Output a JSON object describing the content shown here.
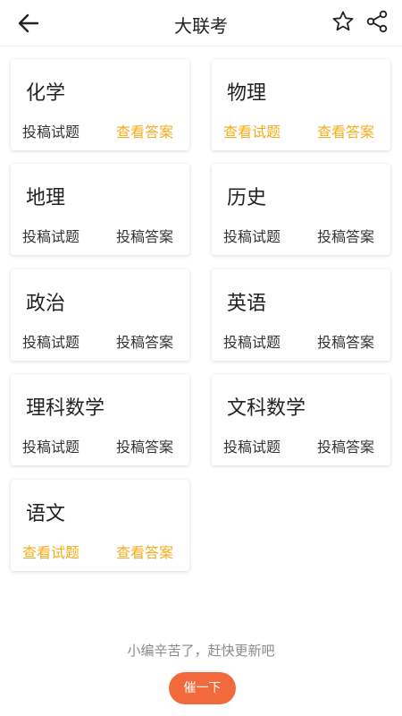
{
  "header": {
    "title": "大联考"
  },
  "colors": {
    "highlight": "#f3ad1b",
    "button": "#f26a3c"
  },
  "cards": [
    {
      "name": "化学",
      "left": "投稿试题",
      "right": "查看答案",
      "left_state": "normal",
      "right_state": "highlight"
    },
    {
      "name": "物理",
      "left": "查看试题",
      "right": "查看答案",
      "left_state": "highlight",
      "right_state": "highlight"
    },
    {
      "name": "地理",
      "left": "投稿试题",
      "right": "投稿答案",
      "left_state": "normal",
      "right_state": "normal"
    },
    {
      "name": "历史",
      "left": "投稿试题",
      "right": "投稿答案",
      "left_state": "normal",
      "right_state": "normal"
    },
    {
      "name": "政治",
      "left": "投稿试题",
      "right": "投稿答案",
      "left_state": "normal",
      "right_state": "normal"
    },
    {
      "name": "英语",
      "left": "投稿试题",
      "right": "投稿答案",
      "left_state": "normal",
      "right_state": "normal"
    },
    {
      "name": "理科数学",
      "left": "投稿试题",
      "right": "投稿答案",
      "left_state": "normal",
      "right_state": "normal"
    },
    {
      "name": "文科数学",
      "left": "投稿试题",
      "right": "投稿答案",
      "left_state": "normal",
      "right_state": "normal"
    },
    {
      "name": "语文",
      "left": "查看试题",
      "right": "查看答案",
      "left_state": "highlight",
      "right_state": "highlight"
    }
  ],
  "footer": {
    "message": "小编辛苦了，赶快更新吧",
    "button_label": "催一下"
  }
}
